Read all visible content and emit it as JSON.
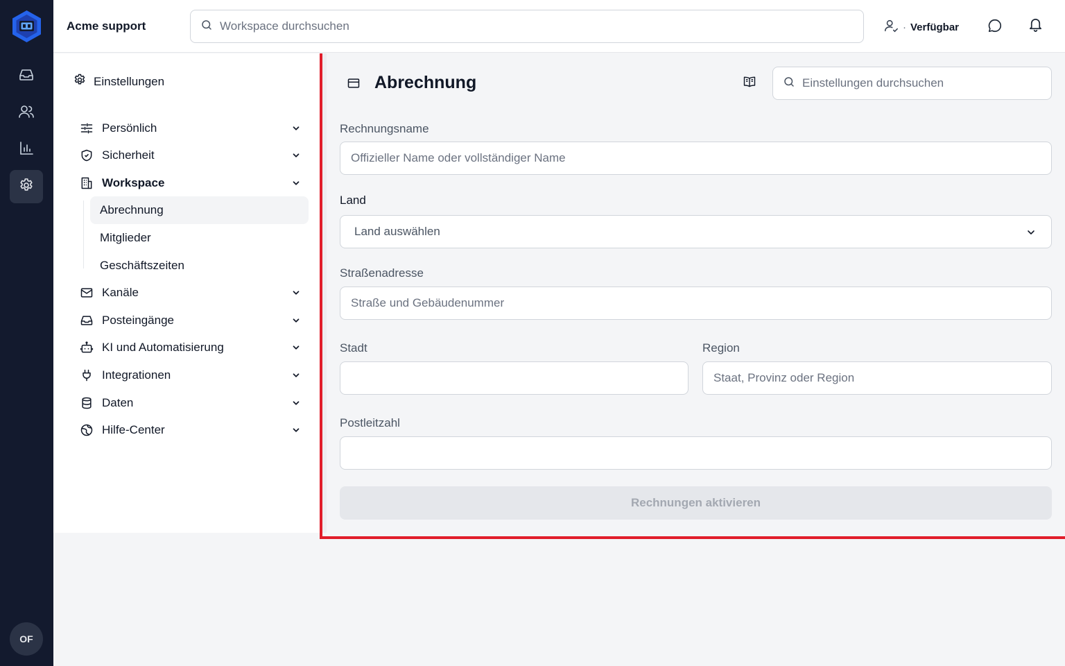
{
  "topbar": {
    "workspace_name": "Acme support",
    "search_placeholder": "Workspace durchsuchen",
    "status_dot": "·",
    "status_label": "Verfügbar"
  },
  "rail": {
    "avatar_initials": "OF",
    "items": [
      {
        "icon": "inbox-icon"
      },
      {
        "icon": "users-icon"
      },
      {
        "icon": "bar-chart-icon"
      },
      {
        "icon": "gear-icon",
        "active": true
      }
    ]
  },
  "sidebar": {
    "header": "Einstellungen",
    "items": [
      {
        "label": "Persönlich",
        "icon": "sliders-icon"
      },
      {
        "label": "Sicherheit",
        "icon": "shield-icon"
      },
      {
        "label": "Workspace",
        "icon": "building-icon"
      },
      {
        "label": "Kanäle",
        "icon": "mail-icon"
      },
      {
        "label": "Posteingänge",
        "icon": "inbox-icon"
      },
      {
        "label": "KI und Automatisierung",
        "icon": "bot-icon"
      },
      {
        "label": "Integrationen",
        "icon": "plug-icon"
      },
      {
        "label": "Daten",
        "icon": "database-icon"
      },
      {
        "label": "Hilfe-Center",
        "icon": "globe-icon"
      }
    ],
    "workspace_sub": [
      "Abrechnung",
      "Mitglieder",
      "Geschäftszeiten"
    ]
  },
  "main": {
    "title": "Abrechnung",
    "settings_search_placeholder": "Einstellungen durchsuchen",
    "form": {
      "invoice_name_label": "Rechnungsname",
      "invoice_name_placeholder": "Offizieller Name oder vollständiger Name",
      "country_label": "Land",
      "country_value": "Land auswählen",
      "street_label": "Straßenadresse",
      "street_placeholder": "Straße und Gebäudenummer",
      "city_label": "Stadt",
      "city_value": "",
      "region_label": "Region",
      "region_placeholder": "Staat, Provinz oder Region",
      "zip_label": "Postleitzahl",
      "zip_value": "",
      "submit_label": "Rechnungen aktivieren"
    }
  },
  "colors": {
    "rail_bg": "#131a2e",
    "brand": "#2563eb",
    "highlight_border": "#e11d2a",
    "disabled_button_bg": "#e5e7eb"
  }
}
